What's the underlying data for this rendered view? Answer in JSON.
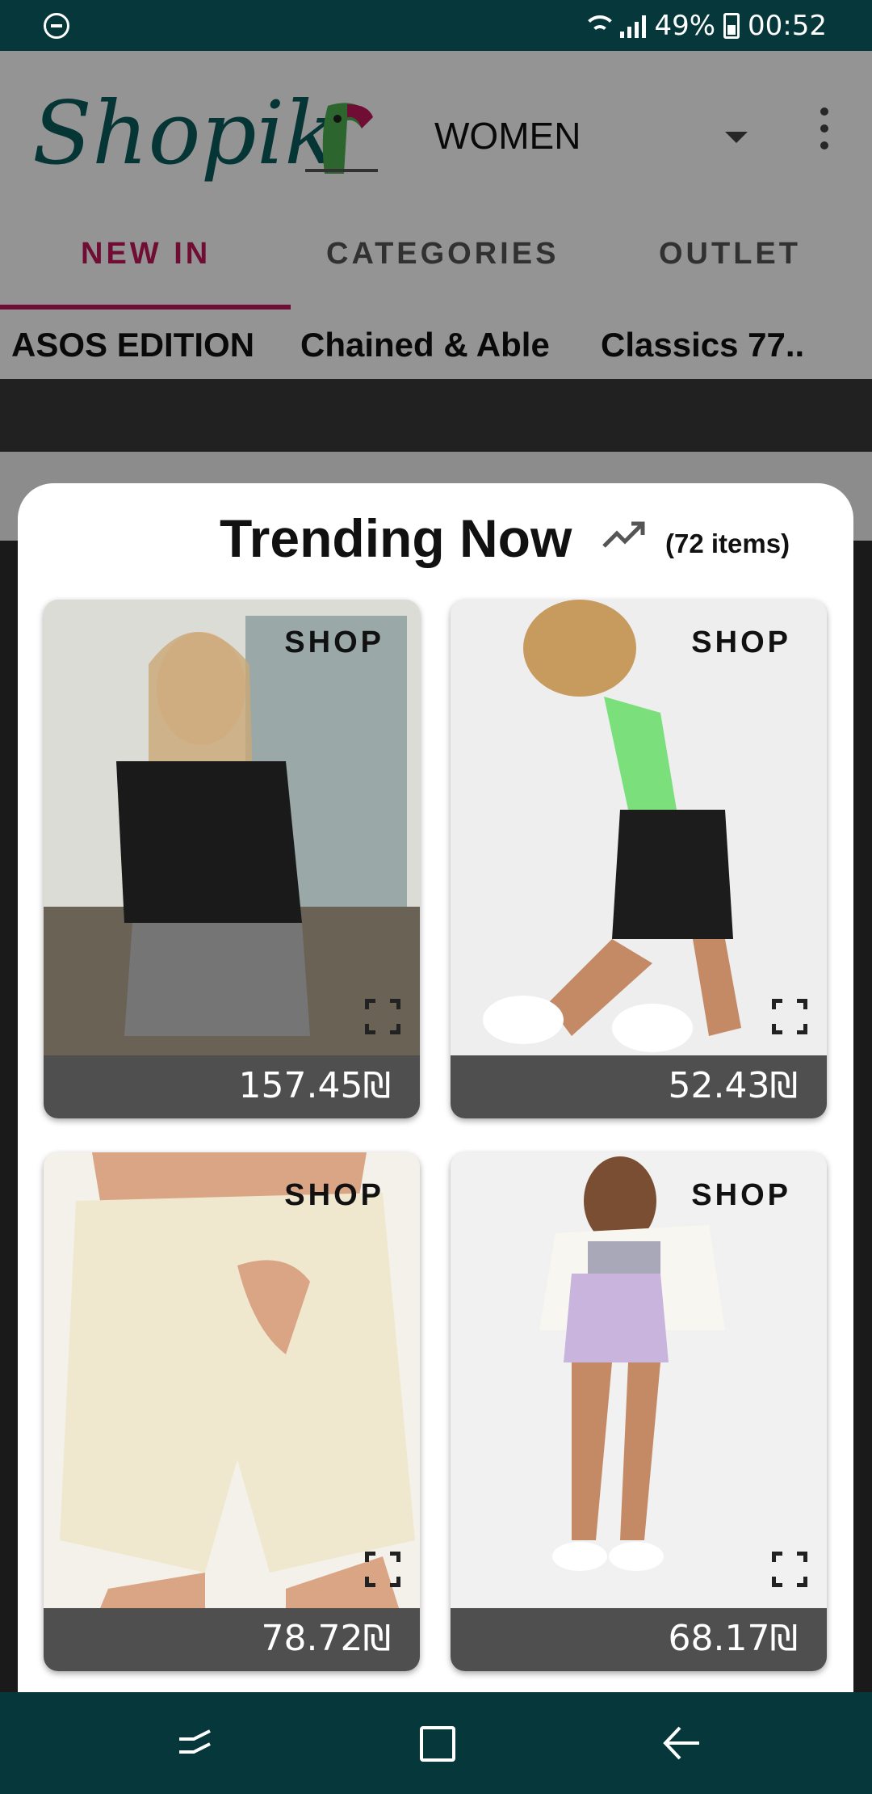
{
  "status_bar": {
    "battery": "49%",
    "time": "00:52"
  },
  "app": {
    "logo": "Shopik",
    "department": "WOMEN",
    "tabs": [
      "NEW IN",
      "CATEGORIES",
      "OUTLET"
    ],
    "active_tab": "NEW IN",
    "brands": [
      "ASOS EDITION",
      "Chained & Able",
      "Classics 77.."
    ]
  },
  "popup": {
    "title": "Trending Now",
    "item_count": "(72 items)",
    "trend_icon": "trending-up-icon",
    "products": [
      {
        "shop_label": "SHOP",
        "price": "157.45₪",
        "image": "woman in black lace-sleeve top and grey denim shorts"
      },
      {
        "shop_label": "SHOP",
        "price": "52.43₪",
        "image": "woman in green bodysuit and black cargo skirt"
      },
      {
        "shop_label": "SHOP",
        "price": "78.72₪",
        "image": "cream jersey shorts with drawstring"
      },
      {
        "shop_label": "SHOP",
        "price": "68.17₪",
        "image": "woman in lilac shorts and white jacket"
      }
    ]
  },
  "nav_bar": {
    "icons": [
      "recent-apps-icon",
      "home-icon",
      "back-icon"
    ]
  },
  "colors": {
    "status_bar": "#06383b",
    "accent": "#c2185b",
    "price_bar": "#4f4f4f"
  }
}
